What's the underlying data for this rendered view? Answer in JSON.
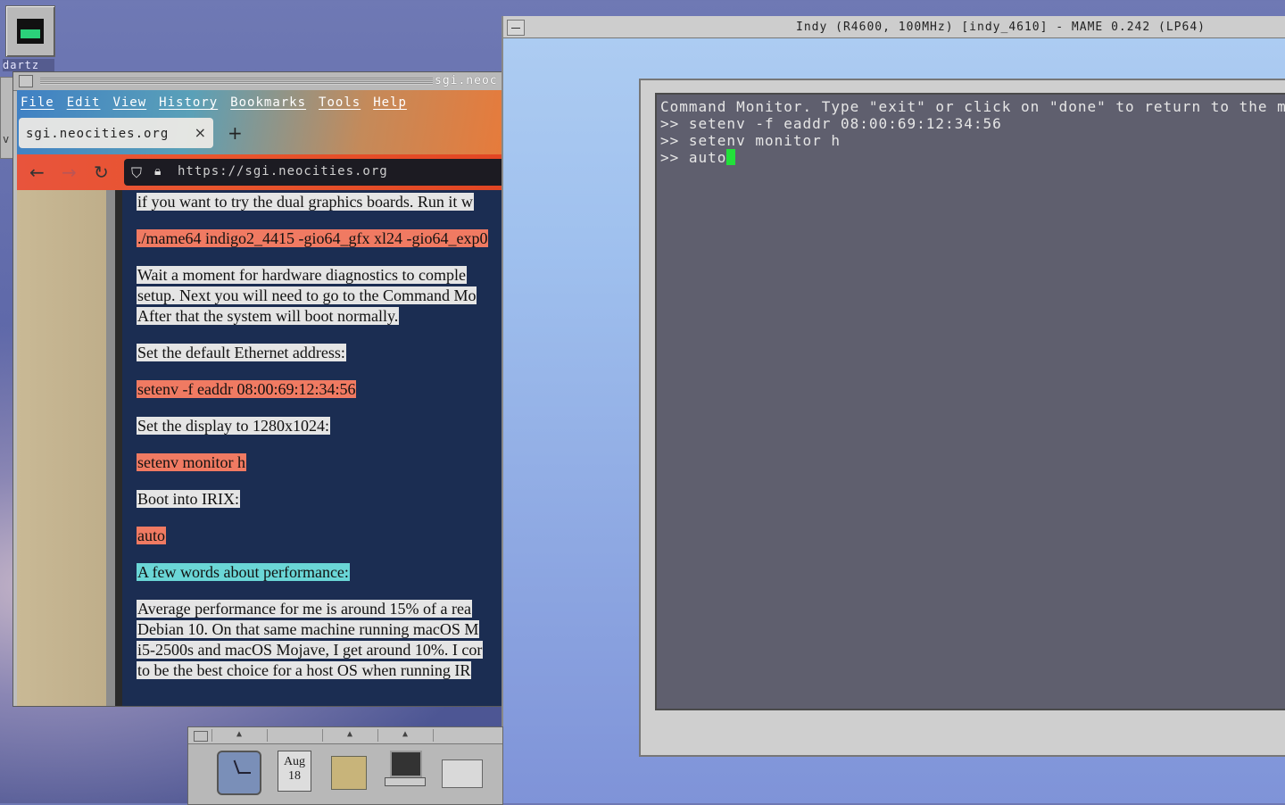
{
  "desktop": {
    "icon_label": "dartz",
    "left_strip_label": "v"
  },
  "browser": {
    "window_title": "sgi.neoc",
    "menu": [
      "File",
      "Edit",
      "View",
      "History",
      "Bookmarks",
      "Tools",
      "Help"
    ],
    "tab_label": "sgi.neocities.org",
    "tab_close": "×",
    "new_tab": "+",
    "nav": {
      "back": "←",
      "forward": "→",
      "reload": "↻"
    },
    "url": "https://sgi.neocities.org",
    "content": [
      {
        "style": "grey",
        "lines": [
          "if you want to try the dual graphics boards. Run it w"
        ]
      },
      {
        "style": "red",
        "lines": [
          "./mame64 indigo2_4415 -gio64_gfx xl24 -gio64_exp0"
        ]
      },
      {
        "style": "grey",
        "lines": [
          "Wait a moment for hardware diagnostics to comple",
          "setup. Next you will need to go to the Command Mo",
          "After that the system will boot normally."
        ]
      },
      {
        "style": "grey",
        "lines": [
          "Set the default Ethernet address:"
        ]
      },
      {
        "style": "red",
        "lines": [
          "setenv -f eaddr 08:00:69:12:34:56"
        ]
      },
      {
        "style": "grey",
        "lines": [
          "Set the display to 1280x1024:"
        ]
      },
      {
        "style": "red",
        "lines": [
          "setenv monitor h"
        ]
      },
      {
        "style": "grey",
        "lines": [
          "Boot into IRIX:"
        ]
      },
      {
        "style": "red",
        "lines": [
          "auto"
        ]
      },
      {
        "style": "teal",
        "lines": [
          "A few words about performance:"
        ]
      },
      {
        "style": "grey",
        "lines": [
          "Average performance for me is around 15% of a rea",
          "Debian 10. On that same machine running macOS M",
          "i5-2500s and macOS Mojave, I get around 10%. I cor",
          "to be the best choice for a host OS when running IR"
        ]
      }
    ]
  },
  "mame": {
    "window_title": "Indy (R4600, 100MHz) [indy_4610] - MAME 0.242 (LP64)",
    "console_lines": [
      "Command Monitor.  Type \"exit\" or click on \"done\" to return to the menu.",
      ">> setenv -f eaddr 08:00:69:12:34:56",
      ">> setenv monitor h",
      ">> auto"
    ]
  },
  "dock": {
    "date_month": "Aug",
    "date_day": "18"
  },
  "colors": {
    "highlight_red": "#f07a62",
    "highlight_teal": "#6ad6d6",
    "cursor_green": "#22e03a"
  }
}
